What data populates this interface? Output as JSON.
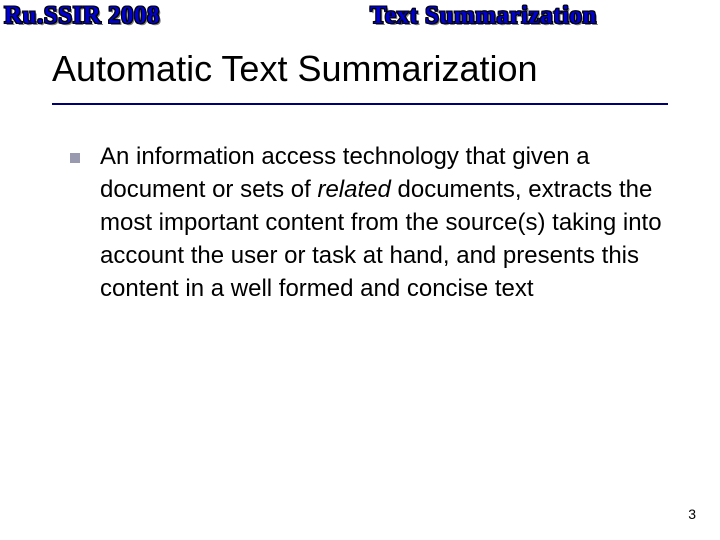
{
  "header": {
    "left": "Ru.SSIR 2008",
    "right": "Text Summarization"
  },
  "title": "Automatic Text Summarization",
  "bullet": {
    "pre_italic": "An information access technology that given a document or sets of ",
    "italic": "related",
    "post_italic": " documents, extracts the most important content from the source(s) taking into account the user or task at hand, and presents this content in a well formed and concise text"
  },
  "page_number": "3"
}
